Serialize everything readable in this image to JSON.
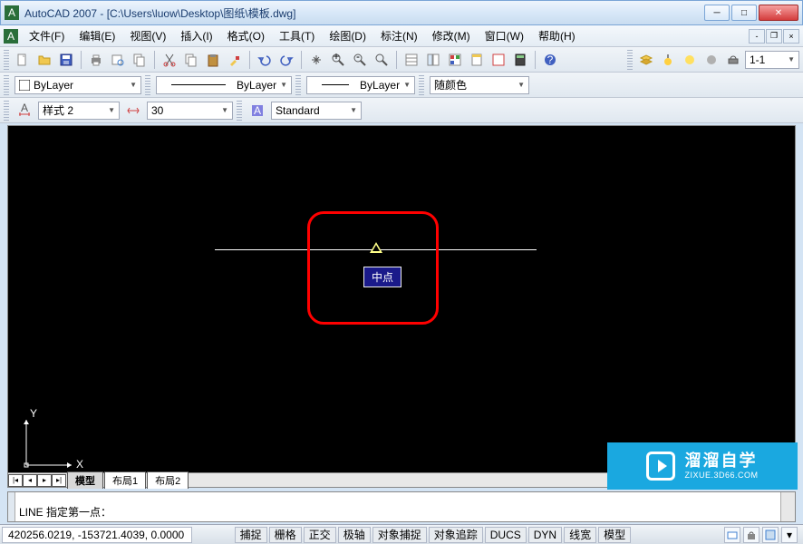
{
  "title": "AutoCAD 2007 - [C:\\Users\\luow\\Desktop\\图纸\\模板.dwg]",
  "menu": {
    "file": "文件(F)",
    "edit": "编辑(E)",
    "view": "视图(V)",
    "insert": "插入(I)",
    "format": "格式(O)",
    "tools": "工具(T)",
    "draw": "绘图(D)",
    "dimension": "标注(N)",
    "modify": "修改(M)",
    "window": "窗口(W)",
    "help": "帮助(H)"
  },
  "properties": {
    "layer": "ByLayer",
    "linetype": "ByLayer",
    "lineweight": "ByLayer",
    "color": "随颜色"
  },
  "styles": {
    "dimstyle": "样式 2",
    "textheight": "30",
    "textstyle": "Standard"
  },
  "snap": {
    "tooltip": "中点"
  },
  "ucs": {
    "x": "X",
    "y": "Y"
  },
  "layout": {
    "model": "模型",
    "layout1": "布局1",
    "layout2": "布局2"
  },
  "command": {
    "prompt": "LINE 指定第一点："
  },
  "status": {
    "coords": "420256.0219, -153721.4039, 0.0000",
    "snap": "捕捉",
    "grid": "栅格",
    "ortho": "正交",
    "polar": "极轴",
    "osnap": "对象捕捉",
    "otrack": "对象追踪",
    "ducs": "DUCS",
    "dyn": "DYN",
    "lwt": "线宽",
    "model": "模型"
  },
  "layers_tool": {
    "scale": "1-1"
  },
  "watermark": {
    "main": "溜溜自学",
    "sub": "ZIXUE.3D66.COM"
  }
}
